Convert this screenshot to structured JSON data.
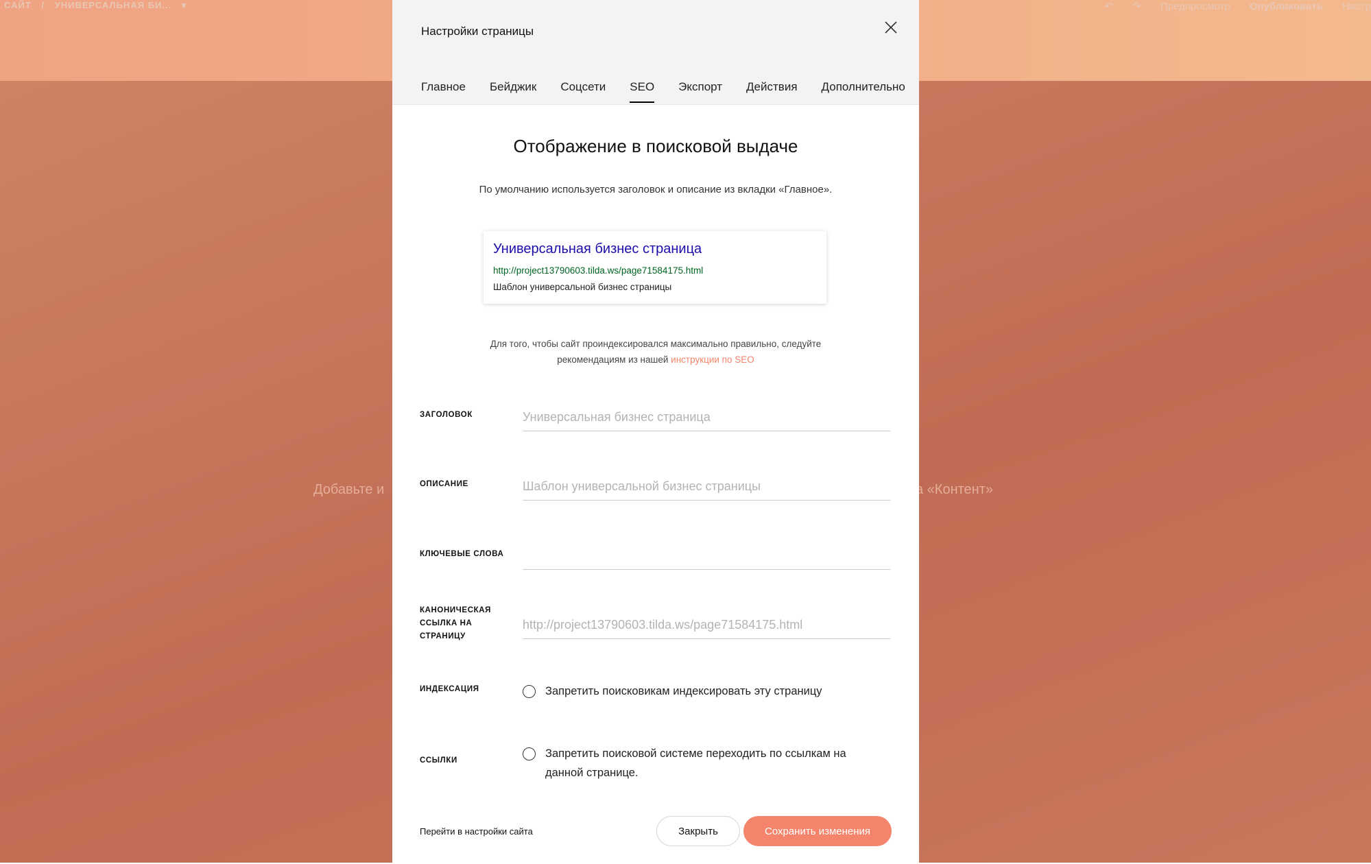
{
  "background": {
    "breadcrumb": [
      "САЙТ",
      "/",
      "УНИВЕРСАЛЬНАЯ БИ...",
      "▾"
    ],
    "toolbar": [
      "↶",
      "↷",
      "Предпросмотр",
      "Опубликовать",
      "Настр"
    ],
    "cover_hint_left": "Добавьте и",
    "cover_hint_right": "а «Контент»"
  },
  "modal": {
    "title": "Настройки страницы",
    "tabs": [
      {
        "label": "Главное"
      },
      {
        "label": "Бейджик"
      },
      {
        "label": "Соцсети"
      },
      {
        "label": "SEO",
        "active": true
      },
      {
        "label": "Экспорт"
      },
      {
        "label": "Действия"
      },
      {
        "label": "Дополнительно"
      }
    ],
    "section_title": "Отображение в поисковой выдаче",
    "section_subtitle": "По умолчанию используется заголовок и описание из вкладки «Главное».",
    "preview": {
      "title": "Универсальная бизнес страница",
      "url": "http://project13790603.tilda.ws/page71584175.html",
      "description": "Шаблон универсальной бизнес страницы"
    },
    "hint": {
      "line1": "Для того, чтобы сайт проиндексировался максимально правильно, следуйте",
      "line2_prefix": "рекомендациям из нашей ",
      "link": "инструкции по SEO"
    },
    "fields": {
      "title_label": "ЗАГОЛОВОК",
      "title_placeholder": "Универсальная бизнес страница",
      "description_label": "ОПИСАНИЕ",
      "description_placeholder": "Шаблон универсальной бизнес страницы",
      "keywords_label": "КЛЮЧЕВЫЕ СЛОВА",
      "keywords_placeholder": "",
      "canonical_label_1": "КАНОНИЧЕСКАЯ",
      "canonical_label_2": "ССЫЛКА НА",
      "canonical_label_3": "СТРАНИЦУ",
      "canonical_placeholder": "http://project13790603.tilda.ws/page71584175.html"
    },
    "indexing": {
      "label": "ИНДЕКСАЦИЯ",
      "option": "Запретить поисковикам индексировать эту страницу",
      "checked": false
    },
    "links": {
      "label": "ССЫЛКИ",
      "option_line1": "Запретить поисковой системе переходить по ссылкам на",
      "option_line2": "данной странице.",
      "checked": false
    },
    "footer": {
      "site_settings_link": "Перейти в настройки сайта",
      "close_button": "Закрыть",
      "save_button": "Сохранить изменения"
    }
  },
  "colors": {
    "accent": "#f4846b",
    "preview_title": "#1a0dab",
    "preview_url": "#006621"
  }
}
